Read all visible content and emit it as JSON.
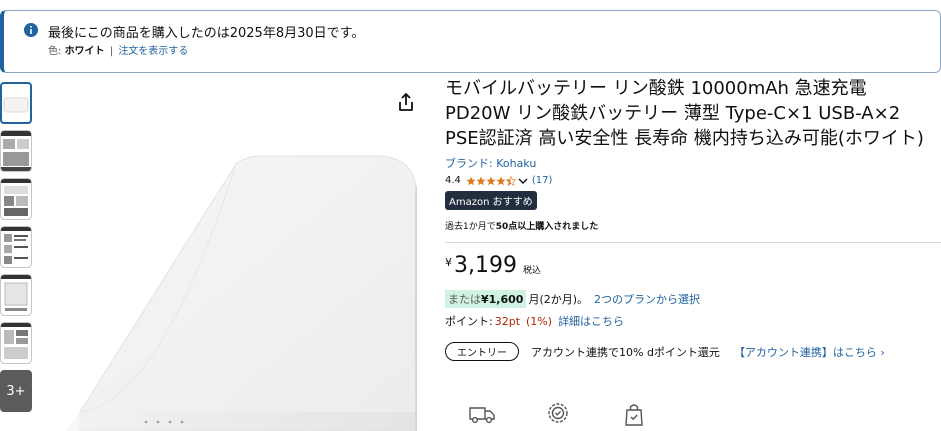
{
  "notice": {
    "icon": "info-icon",
    "message": "最後にこの商品を購入したのは2025年8月30日です。",
    "color_label": "色:",
    "color_value": "ホワイト",
    "separator": "|",
    "view_order_link": "注文を表示する"
  },
  "thumbnails": {
    "more_label": "3+"
  },
  "product": {
    "title": "モバイルバッテリー リン酸鉄 10000mAh 急速充電 PD20W リン酸鉄バッテリー 薄型 Type-C×1 USB-A×2 PSE認証済 高い安全性 長寿命 機内持ち込み可能(ホワイト)",
    "brand_link": "ブランド: Kohaku",
    "rating_value": "4.4",
    "rating_stars": 4.4,
    "review_count": "(17)",
    "badge": "Amazon おすすめ",
    "bought_prefix": "過去1か月で",
    "bought_count": "50点以上購入されました",
    "bought_suffix": ""
  },
  "price": {
    "currency": "¥",
    "amount": "3,199",
    "tax_label": "税込"
  },
  "installment": {
    "prefix": "または",
    "amount": "¥1,600",
    "term": "月(2か月)。",
    "plans_link": "2つのプランから選択"
  },
  "points": {
    "label": "ポイント:",
    "value": "32pt",
    "percent": "(1%)",
    "details_link": "詳細はこちら"
  },
  "entry": {
    "button": "エントリー",
    "text": "アカウント連携で10% dポイント還元",
    "link": "【アカウント連携】はこちら ›"
  },
  "colors": {
    "link": "#2162a1",
    "price_red": "#b12704",
    "badge_bg": "#232f3e",
    "install_highlight": "#cff2e2",
    "star": "#de7921"
  },
  "feature_icons": [
    "delivery-truck-icon",
    "quality-badge-icon",
    "secure-bag-icon"
  ]
}
